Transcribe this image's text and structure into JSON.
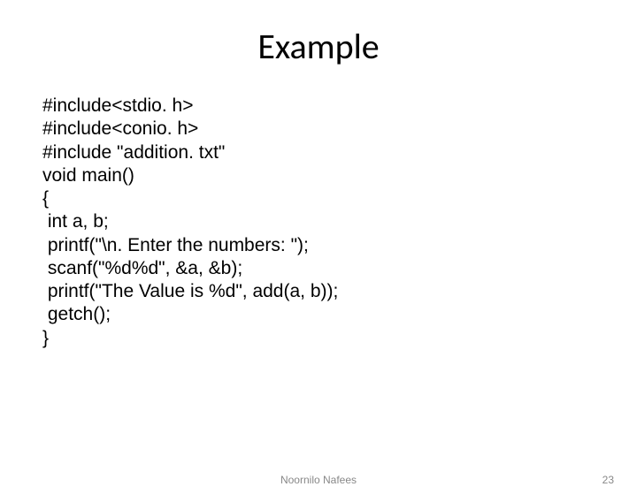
{
  "title": "Example",
  "code": {
    "line1": "#include<stdio. h>",
    "line2": "#include<conio. h>",
    "line3": "#include \"addition. txt\"",
    "line4": "void main()",
    "line5": "{",
    "line6": " int a, b;",
    "line7": " printf(\"\\n. Enter the numbers: \");",
    "line8": " scanf(\"%d%d\", &a, &b);",
    "line9": " printf(\"The Value is %d\", add(a, b));",
    "line10": " getch();",
    "line11": "}"
  },
  "footer": {
    "author": "Noornilo Nafees",
    "page": "23"
  }
}
